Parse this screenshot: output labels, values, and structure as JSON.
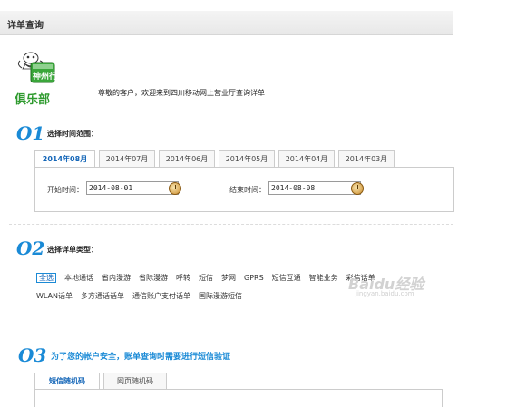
{
  "header": {
    "title": "详单查询"
  },
  "logo": {
    "brand_badge": "神州行",
    "club": "俱乐部"
  },
  "welcome": "尊敬的客户，欢迎来到四川移动网上营业厅查询详单",
  "section1": {
    "number": "O1",
    "title": "选择时间范围：",
    "tabs": [
      "2014年08月",
      "2014年07月",
      "2014年06月",
      "2014年05月",
      "2014年04月",
      "2014年03月"
    ],
    "active_tab": 0,
    "start_label": "开始时间：",
    "start_value": "2014-08-01",
    "end_label": "结束时间：",
    "end_value": "2014-08-08"
  },
  "section2": {
    "number": "O2",
    "title": "选择详单类型：",
    "row1": [
      "全选",
      "本地通话",
      "省内漫游",
      "省际漫游",
      "呼转",
      "短信",
      "梦网",
      "GPRS",
      "短信互通",
      "智能业务",
      "彩信话单"
    ],
    "row2": [
      "WLAN话单",
      "多方通话话单",
      "通信账户支付话单",
      "国际漫游短信"
    ]
  },
  "watermark": {
    "text": "Baidu经验",
    "sub": "jingyan.baidu.com"
  },
  "section3": {
    "number": "O3",
    "title": "为了您的帐户安全，账单查询时需要进行短信验证",
    "tabs": [
      "短信随机码",
      "网页随机码"
    ]
  },
  "colors": {
    "accent": "#1a8ad6",
    "logo_green": "#2e9a2e"
  }
}
